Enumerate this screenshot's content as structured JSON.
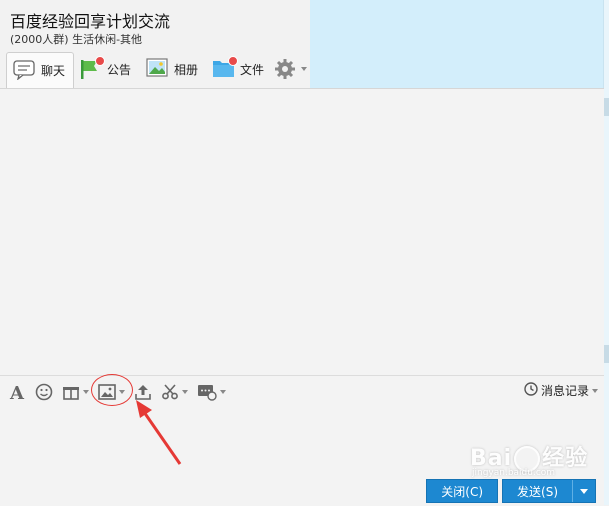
{
  "window": {
    "title": "百度经验回享计划交流",
    "subtitle": "(2000人群) 生活休闲-其他"
  },
  "tabs": [
    {
      "label": "聊天",
      "icon": "chat-bubble-icon",
      "active": true
    },
    {
      "label": "公告",
      "icon": "announcement-flag-icon",
      "badge": true
    },
    {
      "label": "相册",
      "icon": "photo-album-icon"
    },
    {
      "label": "文件",
      "icon": "folder-icon",
      "badge": true
    }
  ],
  "toolbar": {
    "tools": [
      "font-icon",
      "emoji-icon",
      "gift-icon",
      "image-icon",
      "upload-icon",
      "scissors-icon",
      "screen-share-icon"
    ],
    "history_label": "消息记录"
  },
  "buttons": {
    "close_label": "关闭(C)",
    "send_label": "发送(S)"
  },
  "watermark": {
    "brand": "Bai",
    "brand_end": "经验",
    "url": "jingyan.baidu.com"
  },
  "colors": {
    "accent": "#1d88d1",
    "right_panel": "#d3eefb",
    "highlight": "#e53935"
  }
}
